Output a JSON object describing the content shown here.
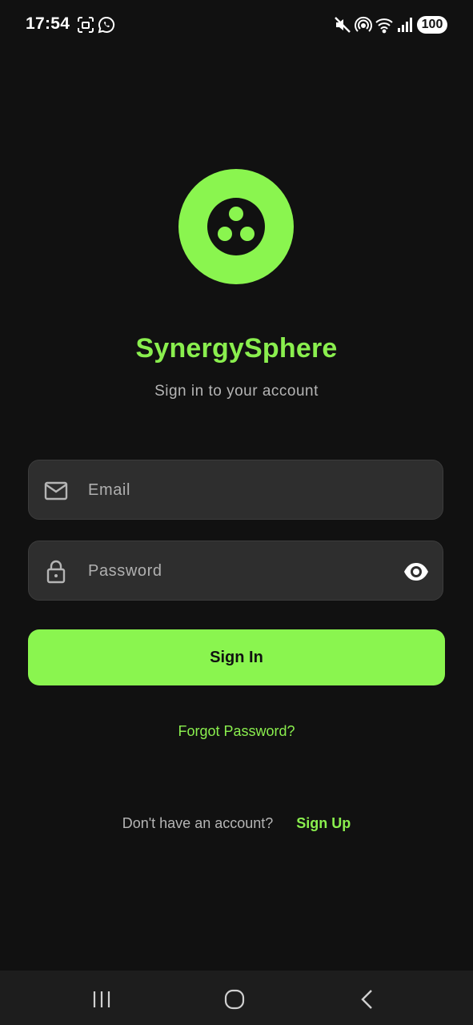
{
  "status_bar": {
    "time": "17:54",
    "battery": "100",
    "left_icons": [
      "screenshot-icon",
      "whatsapp-icon"
    ],
    "right_icons": [
      "mute-icon",
      "hotspot-icon",
      "wifi-icon",
      "signal-icon"
    ]
  },
  "app": {
    "title": "SynergySphere",
    "subtitle": "Sign in to your account",
    "accent_color": "#8af54f",
    "background_color": "#111111"
  },
  "form": {
    "email_placeholder": "Email",
    "email_value": "",
    "password_placeholder": "Password",
    "password_value": "",
    "email_icon": "mail-icon",
    "password_icon": "lock-icon",
    "visibility_icon": "eye-icon",
    "sign_in_label": "Sign In",
    "forgot_label": "Forgot Password?"
  },
  "signup": {
    "prompt": "Don't have an account?",
    "link_label": "Sign Up"
  },
  "nav_bar": {
    "buttons": [
      "recents-icon",
      "home-icon",
      "back-icon"
    ]
  }
}
